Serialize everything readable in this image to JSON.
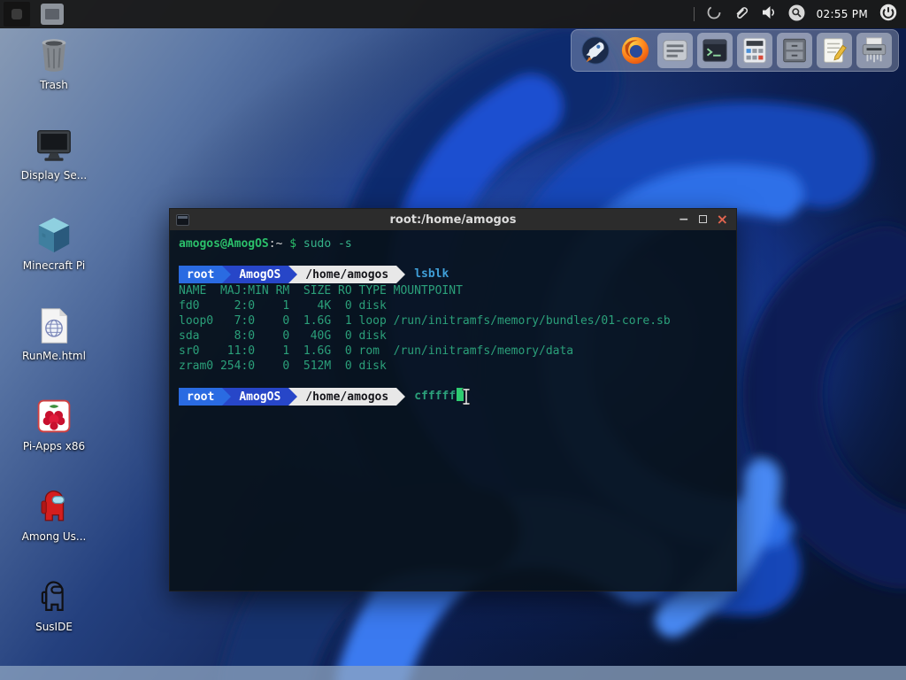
{
  "colors": {
    "panel_bg": "#1a1a1a",
    "terminal_bg": "#08111a",
    "titlebar_bg": "#2c2c2c",
    "output_text": "#2ba07a",
    "command_blue": "#3f9fd8",
    "prompt_green": "#2bbf6a",
    "prompt_seg1_bg": "#2a6be2",
    "prompt_seg2_bg": "#2746c8",
    "prompt_seg3_bg": "#e8e8e8",
    "cursor_green": "#2ecc71",
    "close_button": "#e2654f"
  },
  "taskbar": {
    "clock": "02:55 PM",
    "tray_icons": [
      "status-spinner",
      "clipboard",
      "volume",
      "search",
      "power"
    ]
  },
  "window": {
    "title": "root:/home/amogos",
    "minimize_glyph": "−",
    "close_glyph": "×"
  },
  "terminal": {
    "greeting": {
      "user_host": "amogos@AmogOS",
      "cwd": ":~",
      "symbol": " $ ",
      "command": "sudo -s"
    },
    "prompt": {
      "user": "root",
      "host": "AmogOS",
      "path": "/home/amogos"
    },
    "command1": "lsblk",
    "output": [
      "NAME  MAJ:MIN RM  SIZE RO TYPE MOUNTPOINT",
      "fd0     2:0    1    4K  0 disk ",
      "loop0   7:0    0  1.6G  1 loop /run/initramfs/memory/bundles/01-core.sb",
      "sda     8:0    0   40G  0 disk ",
      "sr0    11:0    1  1.6G  0 rom  /run/initramfs/memory/data",
      "zram0 254:0    0  512M  0 disk "
    ],
    "command2": "cfffff"
  },
  "desktop_icons": [
    {
      "label": "Trash",
      "icon": "trash-icon"
    },
    {
      "label": "Display Se...",
      "icon": "display-icon"
    },
    {
      "label": "Minecraft Pi",
      "icon": "minecraft-cube-icon"
    },
    {
      "label": "RunMe.html",
      "icon": "html-file-icon"
    },
    {
      "label": "Pi-Apps x86",
      "icon": "raspberry-icon"
    },
    {
      "label": "Among Us...",
      "icon": "crewmate-icon"
    },
    {
      "label": "SusIDE",
      "icon": "crewmate-outline-icon"
    }
  ],
  "dock": {
    "items": [
      {
        "name": "web-browser"
      },
      {
        "name": "firefox"
      },
      {
        "name": "window-switcher"
      },
      {
        "name": "terminal"
      },
      {
        "name": "calculator"
      },
      {
        "name": "file-manager"
      },
      {
        "name": "text-editor"
      },
      {
        "name": "paper-shredder"
      }
    ]
  }
}
